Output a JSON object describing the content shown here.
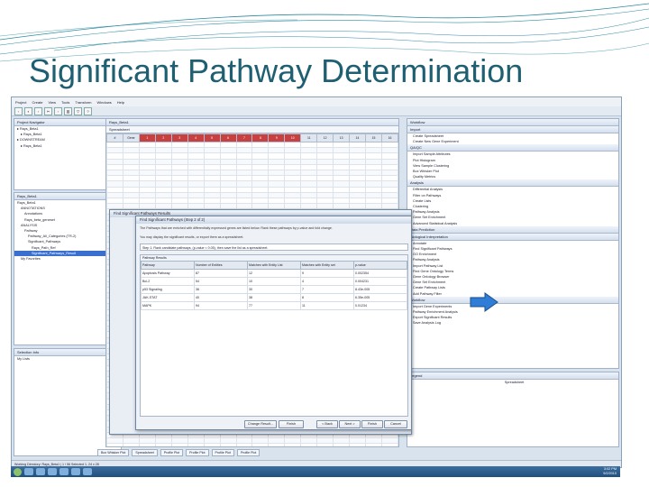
{
  "slide": {
    "title": "Significant Pathway Determination",
    "colors": {
      "title": "#1f5f72",
      "arrow": "#2f7dd6",
      "arrow_border": "#1c4e8c"
    }
  },
  "app": {
    "menu": [
      "Project",
      "Create",
      "View",
      "Tools",
      "Transform",
      "Windows",
      "Help"
    ],
    "project_panel": {
      "title": "Project Navigator",
      "items": [
        "Rays_Beta1",
        "Rays_Beta1",
        "DOWNSTREAM",
        "Rays_Beta1"
      ]
    },
    "spreadsheet_tabs": {
      "tab1": "Rays_Beta1"
    },
    "left_panel2": {
      "title": "Rays_Beta1",
      "items": [
        "Rays_Beta1",
        "ANNOTATIONS",
        "Annotations",
        "Rays_beta_geneset",
        "ANALYSIS",
        "Pathway",
        "Pathway_All_Categories (TR-2)",
        "Significant_Pathways",
        "Rays_Path_Ref",
        "Significant_Pathways_Result",
        "My Favorites"
      ]
    },
    "selection_panel": {
      "title": "Selection Info",
      "item": "My Lists"
    },
    "spreadsheet_header": "Spreadsheet",
    "column_labels": [
      "#",
      "Gene",
      "1",
      "2",
      "3",
      "4",
      "5",
      "6",
      "7",
      "8",
      "9",
      "10",
      "11",
      "12",
      "13",
      "14",
      "15",
      "16"
    ],
    "right_panel": {
      "title": "Workflow",
      "sections": [
        {
          "header": "Import",
          "items": [
            "Create Spreadsheet",
            "Create New Gene Experiment"
          ]
        },
        {
          "header": "QA/QC",
          "items": [
            "Import Sample Attributes",
            "Plot Histogram",
            "View Sample Clustering",
            "Box Whisker Plot",
            "Quality Metrics"
          ]
        },
        {
          "header": "Analysis",
          "items": [
            "Differential Analysis",
            "Filter on Pathways",
            "Create Lists",
            "Clustering",
            "Pathway Analysis",
            "Gene Set Enrichment",
            "Advanced Statistical Analysis"
          ]
        },
        {
          "header": "Data Prediction",
          "items": []
        },
        {
          "header": "Biological Interpretation",
          "items": [
            "Annotate",
            "Find Significant Pathways",
            "GO Enrichment",
            "Pathway Analysis",
            "Import Pathway List",
            "Find Gene Ontology Terms",
            "Gene Ontology Browser",
            "Gene Set Enrichment",
            "Create Pathway Lists",
            "Add Pathway Filter"
          ]
        },
        {
          "header": "Workflow",
          "items": [
            "Import Gene Experiments",
            "Pathway Enrichment Analysis",
            "Export Significant Results",
            "Save Analysis Log"
          ]
        }
      ]
    },
    "legend_panel": {
      "title": "Legend",
      "item": "Spreadsheet"
    },
    "dialog_back": {
      "title": "Find Significant Pathways Results"
    },
    "dialog_front": {
      "title": "Find Significant Pathways (Step 2 of 2)",
      "intro": "The Pathways that are enriched with differentially expressed genes are listed below. Rank these pathways by p-value and fold change.",
      "intro2": "You may display the significant results, or export them as a spreadsheet.",
      "step_label": "Step 1: Rank candidate pathways, (p-value < 0.05), then save the list as a spreadsheet.",
      "section": "Pathway Results",
      "table_headers": [
        "Pathway",
        "Number of Entities",
        "Matches with Entity List",
        "Matches with Entity set",
        "p-value"
      ],
      "rows": [
        [
          "Apoptosis Pathway",
          "87",
          "12",
          "9",
          "0.002354"
        ],
        [
          "Bcl-2",
          "54",
          "10",
          "4",
          "0.004231"
        ],
        [
          "p53 Signaling",
          "36",
          "30",
          "7",
          "8.43e-005"
        ],
        [
          "JAK-STAT",
          "40",
          "38",
          "8",
          "6.35e-005"
        ],
        [
          "MAPK",
          "94",
          "77",
          "11",
          "0.01234"
        ]
      ],
      "buttons": {
        "change": "Change Result...",
        "finish_left": "Finish",
        "back": "< Back",
        "next": "Next >",
        "finish": "Finish",
        "cancel": "Cancel"
      }
    },
    "bottom_tabs": [
      "Box Whisker Plot",
      "Spreadsheet",
      "Profile Plot",
      "Profile Plot",
      "Profile Plot",
      "Profile Plot"
    ],
    "status": "Working Directory: Rays_Beta1  | 1 / 56  Selected 1, 24 x 28",
    "taskbar": {
      "time": "3:02 PM",
      "date": "9/2/2010"
    }
  }
}
